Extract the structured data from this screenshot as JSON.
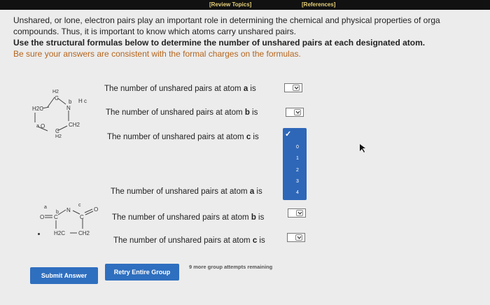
{
  "header": {
    "review_topics": "[Review Topics]",
    "references": "[References]"
  },
  "instructions": {
    "line1": "Unshared, or lone, electron pairs play an important role in determining the chemical and physical properties of orga",
    "line2": "compounds. Thus, it is important to know which atoms carry unshared pairs.",
    "line3": "Use the structural formulas below to determine the number of unshared pairs at each designated atom.",
    "line4": "Be sure your answers are consistent with the formal charges on the formulas."
  },
  "molecule1": {
    "questions": [
      {
        "prefix": "The number of unshared pairs at atom ",
        "atom": "a",
        "suffix": " is"
      },
      {
        "prefix": "The number of unshared pairs at atom ",
        "atom": "b",
        "suffix": " is"
      },
      {
        "prefix": "The number of unshared pairs at atom ",
        "atom": "c",
        "suffix": " is"
      }
    ],
    "labels": {
      "h2_top": "H2",
      "c_top": "C",
      "b": "b",
      "hc": "H c",
      "h2c": "H2C",
      "n": "N",
      "a": "a",
      "o": "O",
      "ch2": "CH2",
      "c_bottom": "C",
      "h2_bottom": "H2"
    }
  },
  "dropdown_open": {
    "checkmark": "✓",
    "options": [
      "0",
      "1",
      "2",
      "3",
      "4"
    ]
  },
  "molecule2": {
    "questions": [
      {
        "prefix": "The number of unshared pairs at atom ",
        "atom": "a",
        "suffix": " is"
      },
      {
        "prefix": "The number of unshared pairs at atom ",
        "atom": "b",
        "suffix": " is"
      },
      {
        "prefix": "The number of unshared pairs at atom ",
        "atom": "c",
        "suffix": " is"
      }
    ],
    "labels": {
      "a": "a",
      "b": "b",
      "c": "c",
      "o_left": "O",
      "c_left": "C",
      "n": "N",
      "c_right": "C",
      "o_right": "O",
      "h2c": "H2C",
      "ch2": "CH2"
    }
  },
  "buttons": {
    "submit": "Submit Answer",
    "retry": "Retry Entire Group"
  },
  "attempts_text": "9 more group attempts remaining",
  "colors": {
    "button": "#2f6fbf",
    "dropdown_open": "#2e67b8",
    "orange_text": "#b5651d"
  }
}
